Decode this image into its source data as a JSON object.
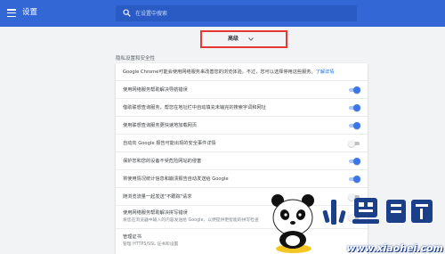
{
  "header": {
    "title": "设置",
    "search_placeholder": "在设置中搜索",
    "color": "#3367d6"
  },
  "advanced": {
    "label": "高级",
    "highlight_color": "#e53935"
  },
  "privacy": {
    "section_title": "隐私设置和安全性",
    "intro": "Google Chrome可能会使用网络服务来改善您的浏览体验。不过，您可以选择停用这些服务。",
    "learn_more": "了解详情",
    "rows": [
      {
        "label": "使用网络服务帮助解决导航错误",
        "enabled": true
      },
      {
        "label": "借助联想查询服务，帮您在地址栏中自动填充未输完的搜索字词和网址",
        "enabled": true
      },
      {
        "label": "使用联想查询服务更快速地加载网页",
        "enabled": true
      },
      {
        "label": "自动向 Google 报告可能出现的安全事件详情",
        "enabled": false
      },
      {
        "label": "保护您和您的设备不受危险网站的侵害",
        "enabled": true
      },
      {
        "label": "将使用情况统计信息和崩溃报告自动发送给 Google",
        "enabled": true
      },
      {
        "label": "随浏览流量一起发送\"不跟踪\"请求",
        "enabled": false
      },
      {
        "label": "使用网络服务帮助解决拼写错误",
        "sublabel": "将您在浏览器中输入的内容发送给 Google，以便提供更智能的拼写检查",
        "enabled": false
      }
    ],
    "certificates": {
      "label": "管理证书",
      "sublabel": "管理 HTTPS/SSL 证书和设置"
    }
  },
  "watermark": {
    "text": "www.xiaohei.com"
  }
}
